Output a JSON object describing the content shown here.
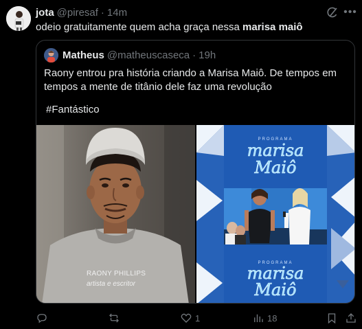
{
  "post": {
    "author_name": "jota",
    "handle": "@piresaf",
    "separator": "·",
    "time": "14m",
    "text_plain": "odeio gratuitamente quem acha graça nessa ",
    "text_bold": "marisa maiô"
  },
  "quote": {
    "author_name": "Matheus",
    "handle": "@matheuscaseca",
    "separator": "·",
    "time": "19h",
    "text": "Raony entrou pra história criando a Marisa Maiô. De tempos em tempos a mente de titânio dele faz uma revolução",
    "hashtag": "#Fantástico",
    "media": {
      "caption_name": "RAONY PHILLIPS",
      "caption_role": "artista e escritor",
      "logo_top_small": "PROGRAMA",
      "logo_top_line1": "marisa",
      "logo_top_line2": "Maiô",
      "logo_bottom_small": "PROGRAMA",
      "logo_bottom_line1": "marisa",
      "logo_bottom_line2": "Maiô"
    }
  },
  "actions": {
    "replies": "",
    "reposts": "",
    "likes": "1",
    "views": "18"
  },
  "colors": {
    "background": "#000000",
    "text": "#e7e9ea",
    "muted": "#71767b",
    "border": "#333639",
    "show_blue": "#1d4f9a"
  }
}
